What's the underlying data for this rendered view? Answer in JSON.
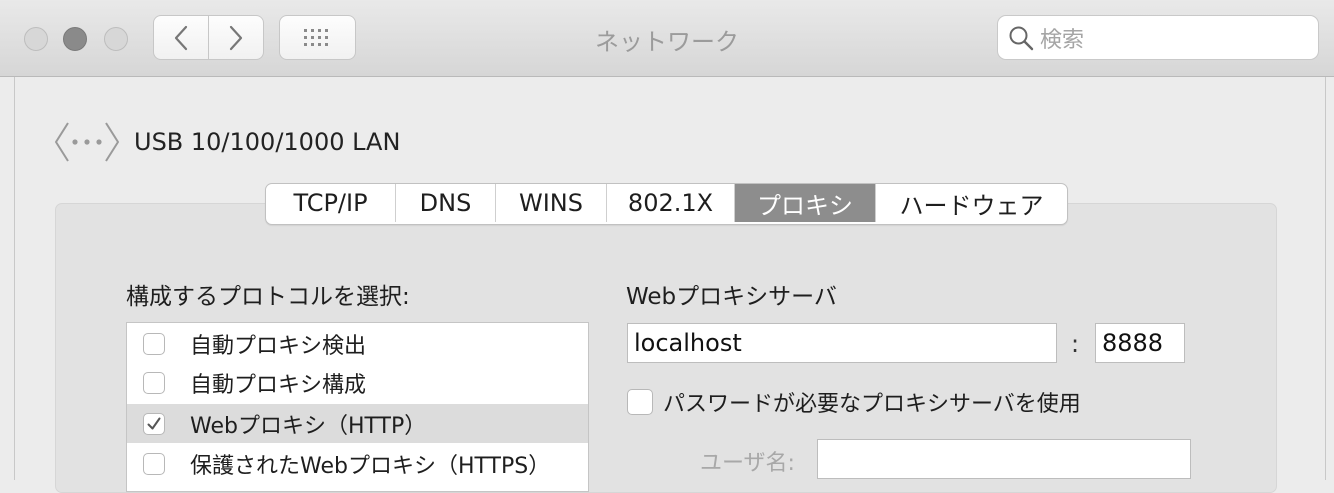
{
  "window": {
    "title": "ネットワーク",
    "search_placeholder": "検索"
  },
  "interface": {
    "name": "USB 10/100/1000 LAN"
  },
  "tabs": [
    {
      "label": "TCP/IP",
      "active": false
    },
    {
      "label": "DNS",
      "active": false
    },
    {
      "label": "WINS",
      "active": false
    },
    {
      "label": "802.1X",
      "active": false
    },
    {
      "label": "プロキシ",
      "active": true
    },
    {
      "label": "ハードウェア",
      "active": false
    }
  ],
  "protocols": {
    "heading": "構成するプロトコルを選択:",
    "items": [
      {
        "label": "自動プロキシ検出",
        "checked": false,
        "selected": false
      },
      {
        "label": "自動プロキシ構成",
        "checked": false,
        "selected": false
      },
      {
        "label": "Webプロキシ（HTTP）",
        "checked": true,
        "selected": true
      },
      {
        "label": "保護されたWebプロキシ（HTTPS）",
        "checked": false,
        "selected": false
      }
    ]
  },
  "proxy": {
    "heading": "Webプロキシサーバ",
    "server": "localhost",
    "separator": ":",
    "port": "8888",
    "password_required_label": "パスワードが必要なプロキシサーバを使用",
    "password_required": false,
    "username_label": "ユーザ名:",
    "username": ""
  },
  "colors": {
    "active_tab": "#8d8d8d",
    "selected_row": "#dcdcdc"
  }
}
